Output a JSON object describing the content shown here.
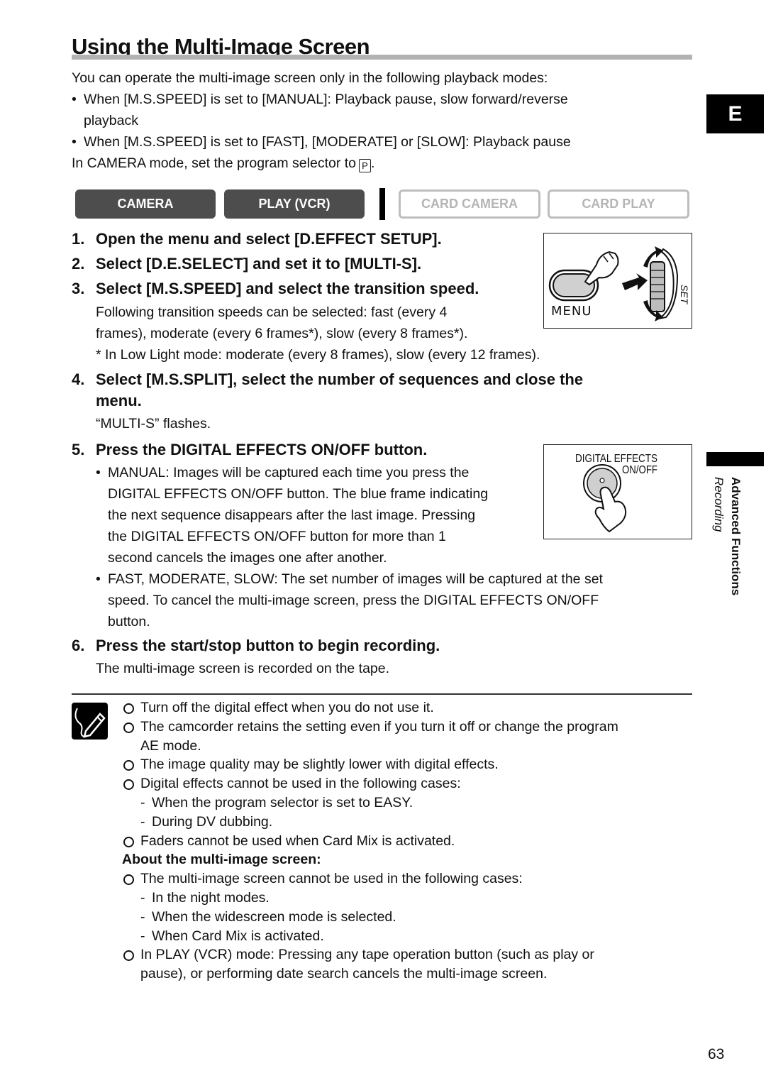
{
  "page": {
    "title": "Using the Multi-Image Screen",
    "intro": "You can operate the multi-image screen only in the following playback modes:",
    "intro_bullets": [
      {
        "line1": "When [M.S.SPEED] is set to [MANUAL]: Playback pause, slow forward/reverse",
        "line2": "playback"
      },
      {
        "line1": "When [M.S.SPEED] is set to [FAST], [MODERATE] or [SLOW]: Playback pause",
        "line2": ""
      }
    ],
    "camera_note": "In CAMERA mode, set the program selector to",
    "program_glyph": "P",
    "camera_note_end": ".",
    "page_number": "63"
  },
  "modes": [
    {
      "label": "CAMERA",
      "active": true
    },
    {
      "label": "PLAY (VCR)",
      "active": true
    },
    {
      "label": "CARD CAMERA",
      "active": false
    },
    {
      "label": "CARD PLAY",
      "active": false
    }
  ],
  "side_tab": {
    "letter": "E",
    "section": "Advanced Functions",
    "subsection": "Recording"
  },
  "steps": [
    {
      "num": "1.",
      "text": "Open the menu and select [D.EFFECT SETUP]."
    },
    {
      "num": "2.",
      "text": "Select [D.E.SELECT] and set it to [MULTI-S]."
    },
    {
      "num": "3.",
      "text": "Select [M.S.SPEED] and select the transition speed.",
      "details": [
        "Following transition speeds can be selected: fast (every 4",
        "frames), moderate (every 6 frames*), slow (every 8 frames*).",
        "* In Low Light mode: moderate (every 8 frames), slow (every 12 frames)."
      ]
    },
    {
      "num": "4.",
      "text": "Select [M.S.SPLIT], select the number of sequences and close the",
      "text2": "menu.",
      "details": [
        "“MULTI-S” flashes."
      ]
    },
    {
      "num": "5.",
      "text": "Press the DIGITAL EFFECTS ON/OFF button.",
      "bullets": [
        [
          "MANUAL: Images will be captured each time you press the",
          "DIGITAL EFFECTS ON/OFF button. The blue frame indicating",
          "the next sequence disappears after the last image. Pressing",
          "the DIGITAL EFFECTS ON/OFF button for more than 1",
          "second cancels the images one after another."
        ],
        [
          "FAST, MODERATE, SLOW: The set number of images will be captured at the set",
          "speed. To cancel the multi-image screen, press the DIGITAL EFFECTS ON/OFF",
          "button."
        ]
      ]
    },
    {
      "num": "6.",
      "text": "Press the start/stop button to begin recording.",
      "details": [
        "The multi-image screen is recorded on the tape."
      ]
    }
  ],
  "figures": {
    "menu": {
      "label": "MENU",
      "dial_label": "SET"
    },
    "digital_effects": {
      "label1": "DIGITAL EFFECTS",
      "label2": "ON/OFF"
    }
  },
  "notes": {
    "items": [
      {
        "type": "circ",
        "text": "Turn off the digital effect when you do not use it."
      },
      {
        "type": "circ",
        "text": "The camcorder retains the setting even if you turn it off or change the program"
      },
      {
        "type": "cont",
        "text": "AE mode."
      },
      {
        "type": "circ",
        "text": "The image quality may be slightly lower with digital effects."
      },
      {
        "type": "circ",
        "text": "Digital effects cannot be used in the following cases:"
      },
      {
        "type": "dash",
        "text": "When the program selector is set to EASY."
      },
      {
        "type": "dash",
        "text": "During DV dubbing."
      },
      {
        "type": "circ",
        "text": "Faders cannot be used when Card Mix is activated."
      },
      {
        "type": "head",
        "text": "About the multi-image screen:"
      },
      {
        "type": "circ",
        "text": "The multi-image screen cannot be used in the following cases:"
      },
      {
        "type": "dash",
        "text": "In the night modes."
      },
      {
        "type": "dash",
        "text": "When the widescreen mode is selected."
      },
      {
        "type": "dash",
        "text": "When Card Mix is activated."
      },
      {
        "type": "circ",
        "text": "In PLAY (VCR) mode: Pressing any tape operation button (such as play or"
      },
      {
        "type": "cont",
        "text": "pause), or performing date search cancels the multi-image screen."
      }
    ]
  }
}
